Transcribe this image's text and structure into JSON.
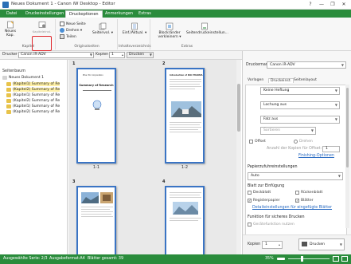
{
  "window": {
    "title": "Neues Dokument 1 - Canon iW Desktop - Editor",
    "controls": [
      "?",
      "—",
      "❐",
      "✕"
    ]
  },
  "ribbon_tabs": [
    "Datei",
    "Druckeinstellungen",
    "Druckoptionen",
    "Anmerkungen",
    "Extras"
  ],
  "ribbon": {
    "groups": {
      "kapitel": {
        "label": "Kapitel",
        "new_chapter": "Neues Kap.",
        "highlighted_button": "Kapiteleinst."
      },
      "originalseiten": {
        "label": "Originalseiten",
        "neue_seite": "Neue Seite",
        "drehen": "Drehen ▾",
        "teilen": "Teilen",
        "seitenvol": "Seitenvol. ▾"
      },
      "inhaltsverzeichnis": {
        "label": "Inhaltsverzeichnis",
        "einf_aktual": "Einf./Aktual. ▾"
      },
      "extras": {
        "label": "Extras",
        "blockraender": "Blockränder verkleinern ▾",
        "seitendruckeinstellungen": "Seitendruckeinstellun..."
      }
    }
  },
  "toolbar": {
    "drucker_label": "Drucker",
    "drucker_value": "Canon iR-ADV",
    "kopien_label": "Kopien",
    "kopien_value": "1",
    "drucken_label": "Drucken",
    "anmerkungen_label": "Anmerkungen ans..."
  },
  "tree": {
    "header": "Seitenbaum",
    "items": [
      "Neues Dokument 1",
      "(Kapitel1) Summary of Re",
      "(Kapitel2) Summary of Re",
      "(Kapitel1) Summary of Re",
      "(Kapitel2) Summary of Re",
      "(Kapitel1) Summary of Re",
      "(Kapitel2) Summary of Re"
    ]
  },
  "pages": [
    {
      "number": "1",
      "label": "1-1",
      "title": "Summary of Research"
    },
    {
      "number": "2",
      "label": "1-2",
      "title": "Introduction of BIO PHARMA"
    },
    {
      "number": "3",
      "label": "",
      "title": ""
    },
    {
      "number": "4",
      "label": "",
      "title": ""
    }
  ],
  "right_panel": {
    "druckername_label": "Druckername:",
    "druckername_value": "Canon iR-ADV",
    "tabs": [
      "Vorlagen",
      "Druckeinst.",
      "Seitenlayout"
    ],
    "keine_heftung": "Keine Heftung",
    "lochung": "Lochung aus",
    "falz": "Falz aus",
    "sortieren": "Sortieren",
    "offset": "Offset",
    "drehen": "Drehen",
    "anzahl_kopien": "Anzahl der Kopien für Offset:",
    "anzahl_value": "1",
    "finishing_link": "Finishing-Optionen",
    "papierzufuhr_header": "Papierzufuhreinstellungen",
    "papierzufuhr_value": "Auto",
    "blatt_header": "Blatt zur Einfügung",
    "deckblatt": "Deckblatt",
    "rueckenblatt": "Rückenblatt",
    "registerpapier": "Registerpapier",
    "blaetter": "Blätter",
    "detail_link": "Detaileinstellungen für eingefügte Blätter",
    "sicheres_header": "Funktion für sicheres Drucken",
    "geraetefunktion": "Gerätefunktion nutzen",
    "kopien_label": "Kopien",
    "kopien_value": "1",
    "drucken_button": "Drucken"
  },
  "status": {
    "ausgewaehlte": "Ausgewählte Serie: 2/3",
    "ausgabeformat": "Ausgabeformat:A4",
    "blaetter_gesamt": "Blätter gesamt: 39",
    "zoom": "35%"
  },
  "colors": {
    "accent_green": "#2a8c3c",
    "page_border_blue": "#3a74c4",
    "highlight_red": "#e0262b",
    "tree_selection": "#fff1a8"
  }
}
